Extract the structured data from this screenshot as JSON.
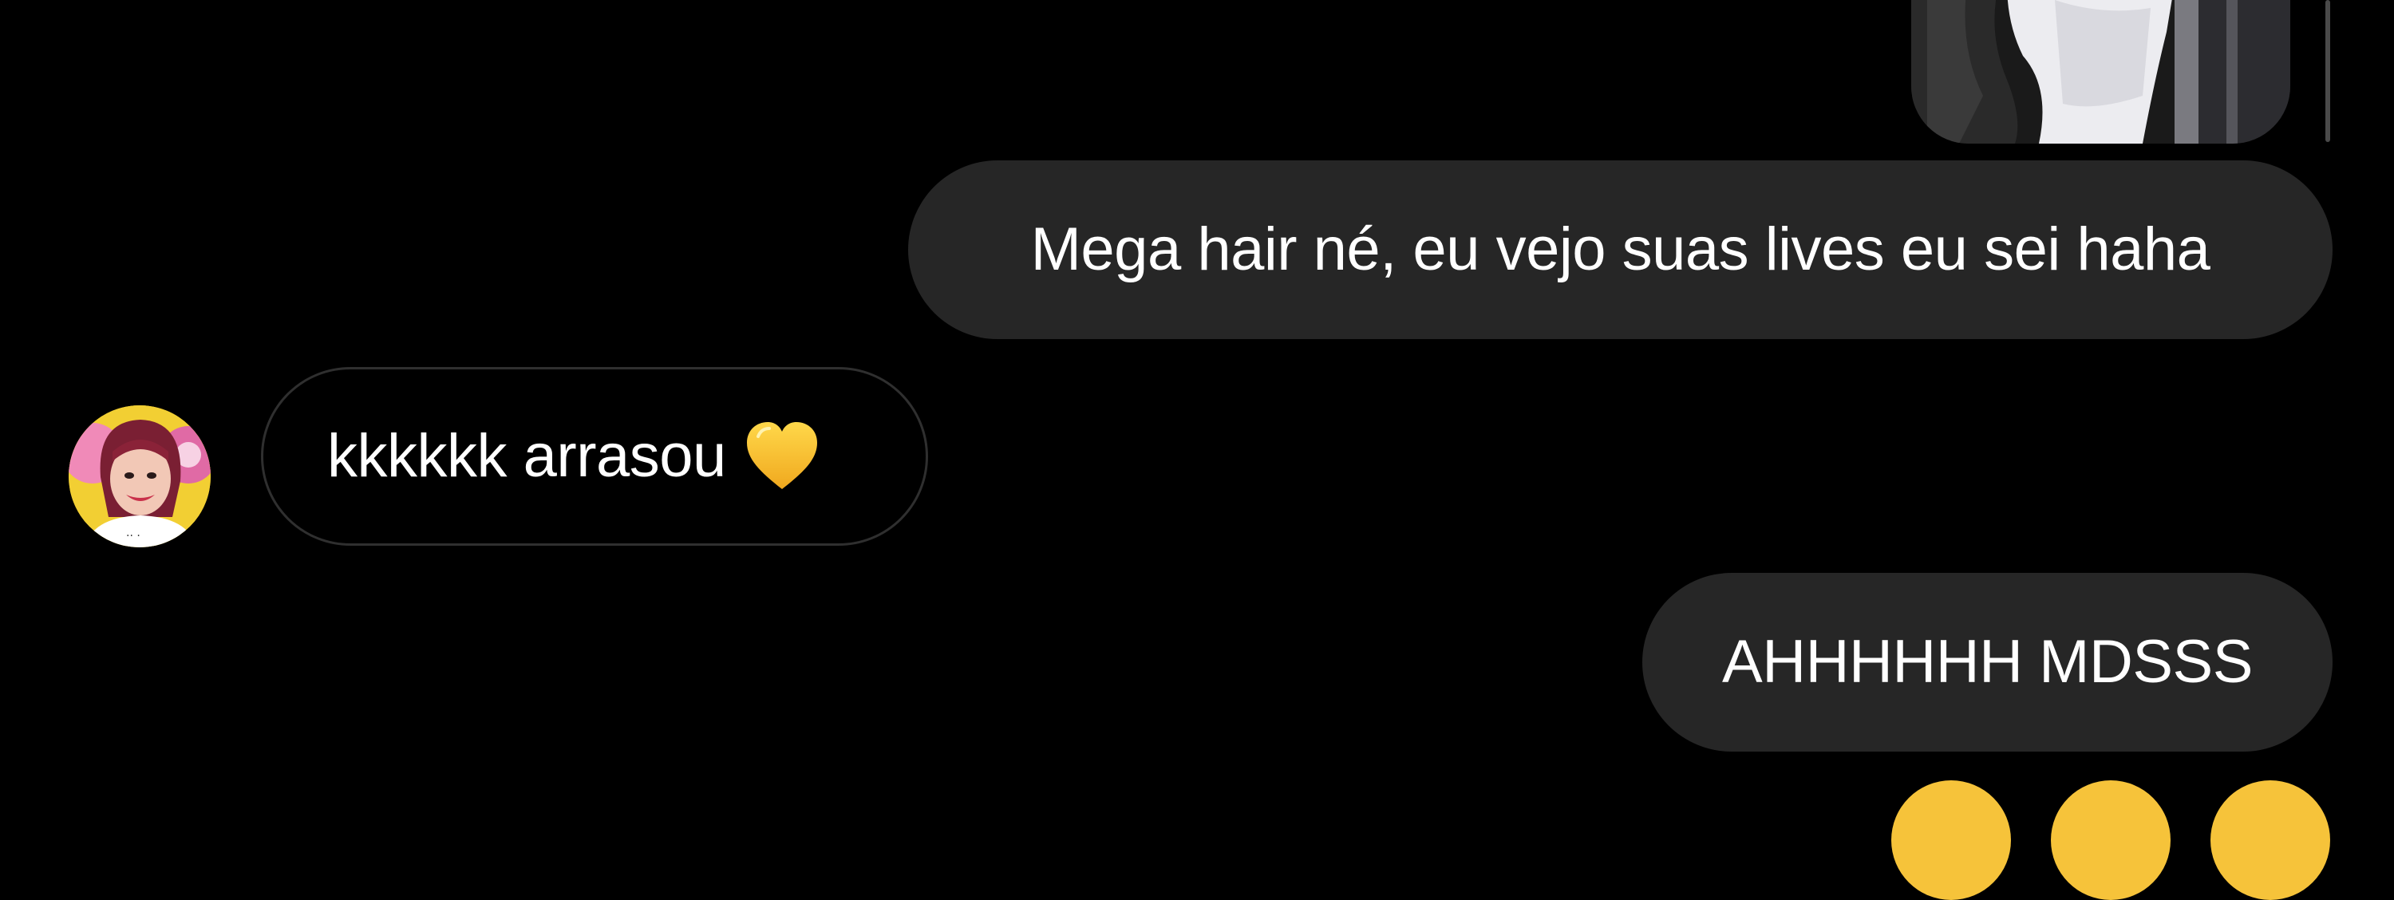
{
  "colors": {
    "background": "#000000",
    "sent_bubble": "#262626",
    "received_border": "#2f2f2f",
    "text": "#ffffff",
    "heart": "#f7c52f"
  },
  "conversation": {
    "messages": [
      {
        "direction": "sent",
        "type": "image"
      },
      {
        "direction": "sent",
        "type": "text",
        "text": "Mega hair né, eu vejo suas lives eu sei haha"
      },
      {
        "direction": "received",
        "type": "text",
        "text": "kkkkkk arrasou",
        "emoji": "yellow-heart-icon"
      },
      {
        "direction": "sent",
        "type": "text",
        "text": "AHHHHHH MDSSS"
      }
    ],
    "partial_reactions": [
      "emoji-icon",
      "emoji-icon",
      "emoji-icon"
    ]
  }
}
